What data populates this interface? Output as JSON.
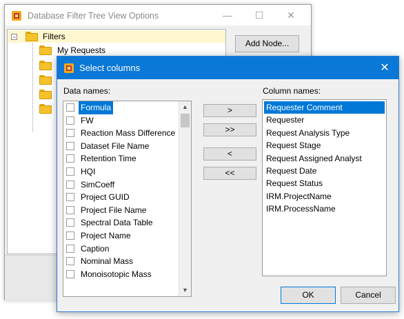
{
  "back_window": {
    "title": "Database Filter Tree View Options",
    "minimize_glyph": "—",
    "maximize_glyph": "☐",
    "close_glyph": "✕",
    "tree": {
      "root_label": "Filters",
      "root_expander": "−",
      "items": [
        "My Requests"
      ]
    },
    "add_node_label": "Add Node..."
  },
  "dialog": {
    "title": "Select columns",
    "close_glyph": "✕",
    "data_names_label": "Data names:",
    "column_names_label": "Column names:",
    "data_names": [
      "Formula",
      "FW",
      "Reaction Mass Difference",
      "Dataset File Name",
      "Retention Time",
      "HQI",
      "SimCoeff",
      "Project GUID",
      "Project File Name",
      "Spectral Data Table",
      "Project Name",
      "Caption",
      "Nominal Mass",
      "Monoisotopic Mass"
    ],
    "selected_data_name_index": 0,
    "column_names": [
      "Requester Comment",
      "Requester",
      "Request Analysis Type",
      "Request Stage",
      "Request Assigned Analyst",
      "Request Date",
      "Request Status",
      "IRM.ProjectName",
      "IRM.ProcessName"
    ],
    "selected_column_name_index": 0,
    "move_buttons": {
      "add_one": ">",
      "add_all": ">>",
      "remove_one": "<",
      "remove_all": "<<"
    },
    "scroll_up_glyph": "▲",
    "scroll_down_glyph": "▼",
    "ok_label": "OK",
    "cancel_label": "Cancel"
  },
  "colors": {
    "dialog_titlebar": "#0b78d7",
    "selection": "#0078d7",
    "folder": "#f6c12b"
  }
}
